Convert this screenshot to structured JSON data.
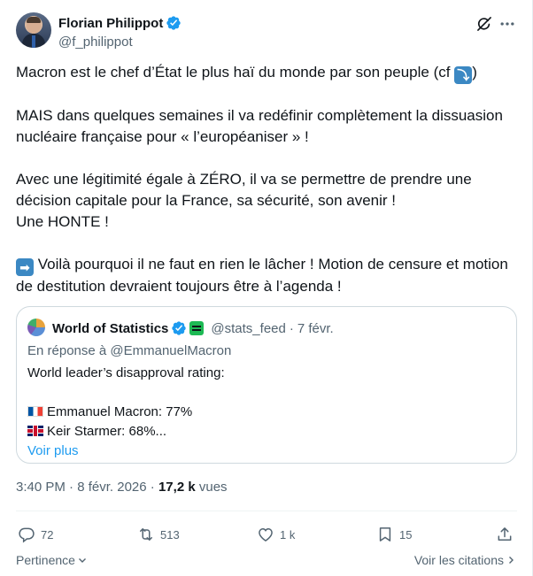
{
  "author": {
    "display_name": "Florian Philippot",
    "handle": "@f_philippot"
  },
  "tweet": {
    "line1_a": "Macron est le chef d’État le plus haï du monde par son peuple (cf ",
    "line1_emoji": "⤵",
    "line1_b": ")",
    "para2": "MAIS dans quelques semaines il va redéfinir complètement la dissuasion nucléaire française pour « l’européaniser » !",
    "para3": "Avec une légitimité égale à ZÉRO, il va se permettre de prendre une décision capitale pour la France, sa sécurité, son avenir !",
    "para3b": "Une HONTE !",
    "para4_emoji": "➡",
    "para4": " Voilà pourquoi il ne faut en rien le lâcher ! Motion de censure et motion de destitution devraient toujours être à l’agenda !"
  },
  "quote": {
    "name": "World of Statistics",
    "handle": "@stats_feed",
    "dot": "·",
    "date": "7 févr.",
    "reply_to": "En réponse à @EmmanuelMacron",
    "line1": "World leader’s disapproval rating:",
    "line2": "Emmanuel Macron: 77%",
    "line3": "Keir Starmer: 68%...",
    "see_more": "Voir plus"
  },
  "meta": {
    "time": "3:40 PM",
    "dot1": " · ",
    "date": "8 févr. 2026",
    "dot2": " · ",
    "views_count": "17,2 k",
    "views_label": " vues"
  },
  "actions": {
    "replies": "72",
    "reposts": "513",
    "likes": "1 k",
    "bookmarks": "15"
  },
  "footer": {
    "relevance": "Pertinence",
    "quotes_link": "Voir les citations"
  },
  "colors": {
    "accent": "#1d9bf0",
    "text": "#0f1419",
    "secondary": "#536471"
  }
}
